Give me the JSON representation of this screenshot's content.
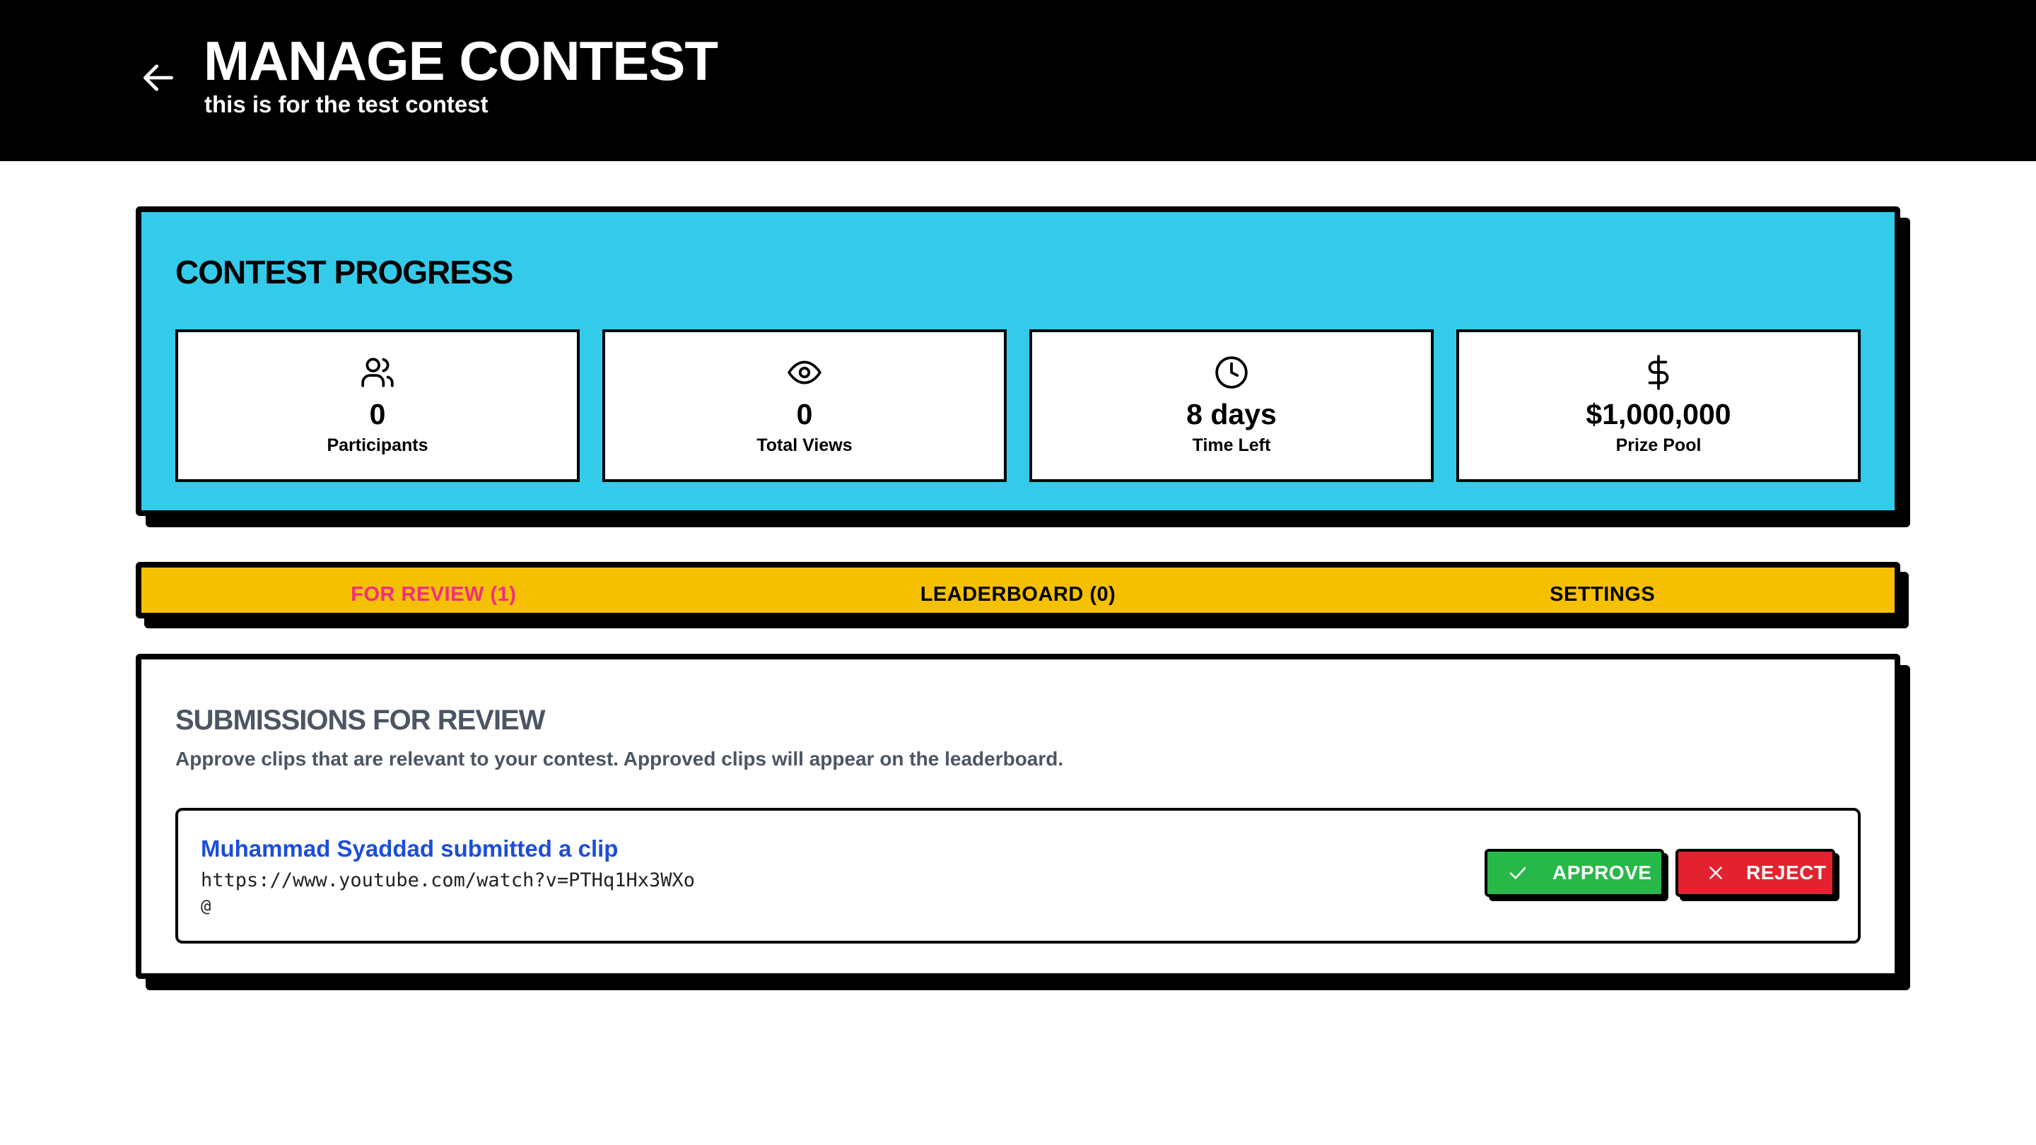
{
  "header": {
    "title": "MANAGE CONTEST",
    "subtitle": "this is for the test contest",
    "back_icon": "arrow-left-icon"
  },
  "progress": {
    "title": "CONTEST PROGRESS",
    "background_color": "#34cbeb",
    "stats": [
      {
        "icon": "users-icon",
        "value": "0",
        "label": "Participants"
      },
      {
        "icon": "eye-icon",
        "value": "0",
        "label": "Total Views"
      },
      {
        "icon": "clock-icon",
        "value": "8 days",
        "label": "Time Left"
      },
      {
        "icon": "dollar-icon",
        "value": "$1,000,000",
        "label": "Prize Pool"
      }
    ]
  },
  "tabs": {
    "background_color": "#f5c000",
    "active_color": "#ef2f83",
    "items": [
      {
        "label": "FOR REVIEW (1)",
        "active": true
      },
      {
        "label": "LEADERBOARD (0)",
        "active": false
      },
      {
        "label": "SETTINGS",
        "active": false
      }
    ]
  },
  "submissions": {
    "title": "SUBMISSIONS FOR REVIEW",
    "description": "Approve clips that are relevant to your contest. Approved clips will appear on the leaderboard.",
    "items": [
      {
        "title": "Muhammad Syaddad submitted a clip",
        "url": "https://www.youtube.com/watch?v=PTHq1Hx3WXo",
        "handle": "@",
        "approve_label": "APPROVE",
        "reject_label": "REJECT",
        "approve_color": "#28b84a",
        "reject_color": "#e2232f"
      }
    ]
  }
}
